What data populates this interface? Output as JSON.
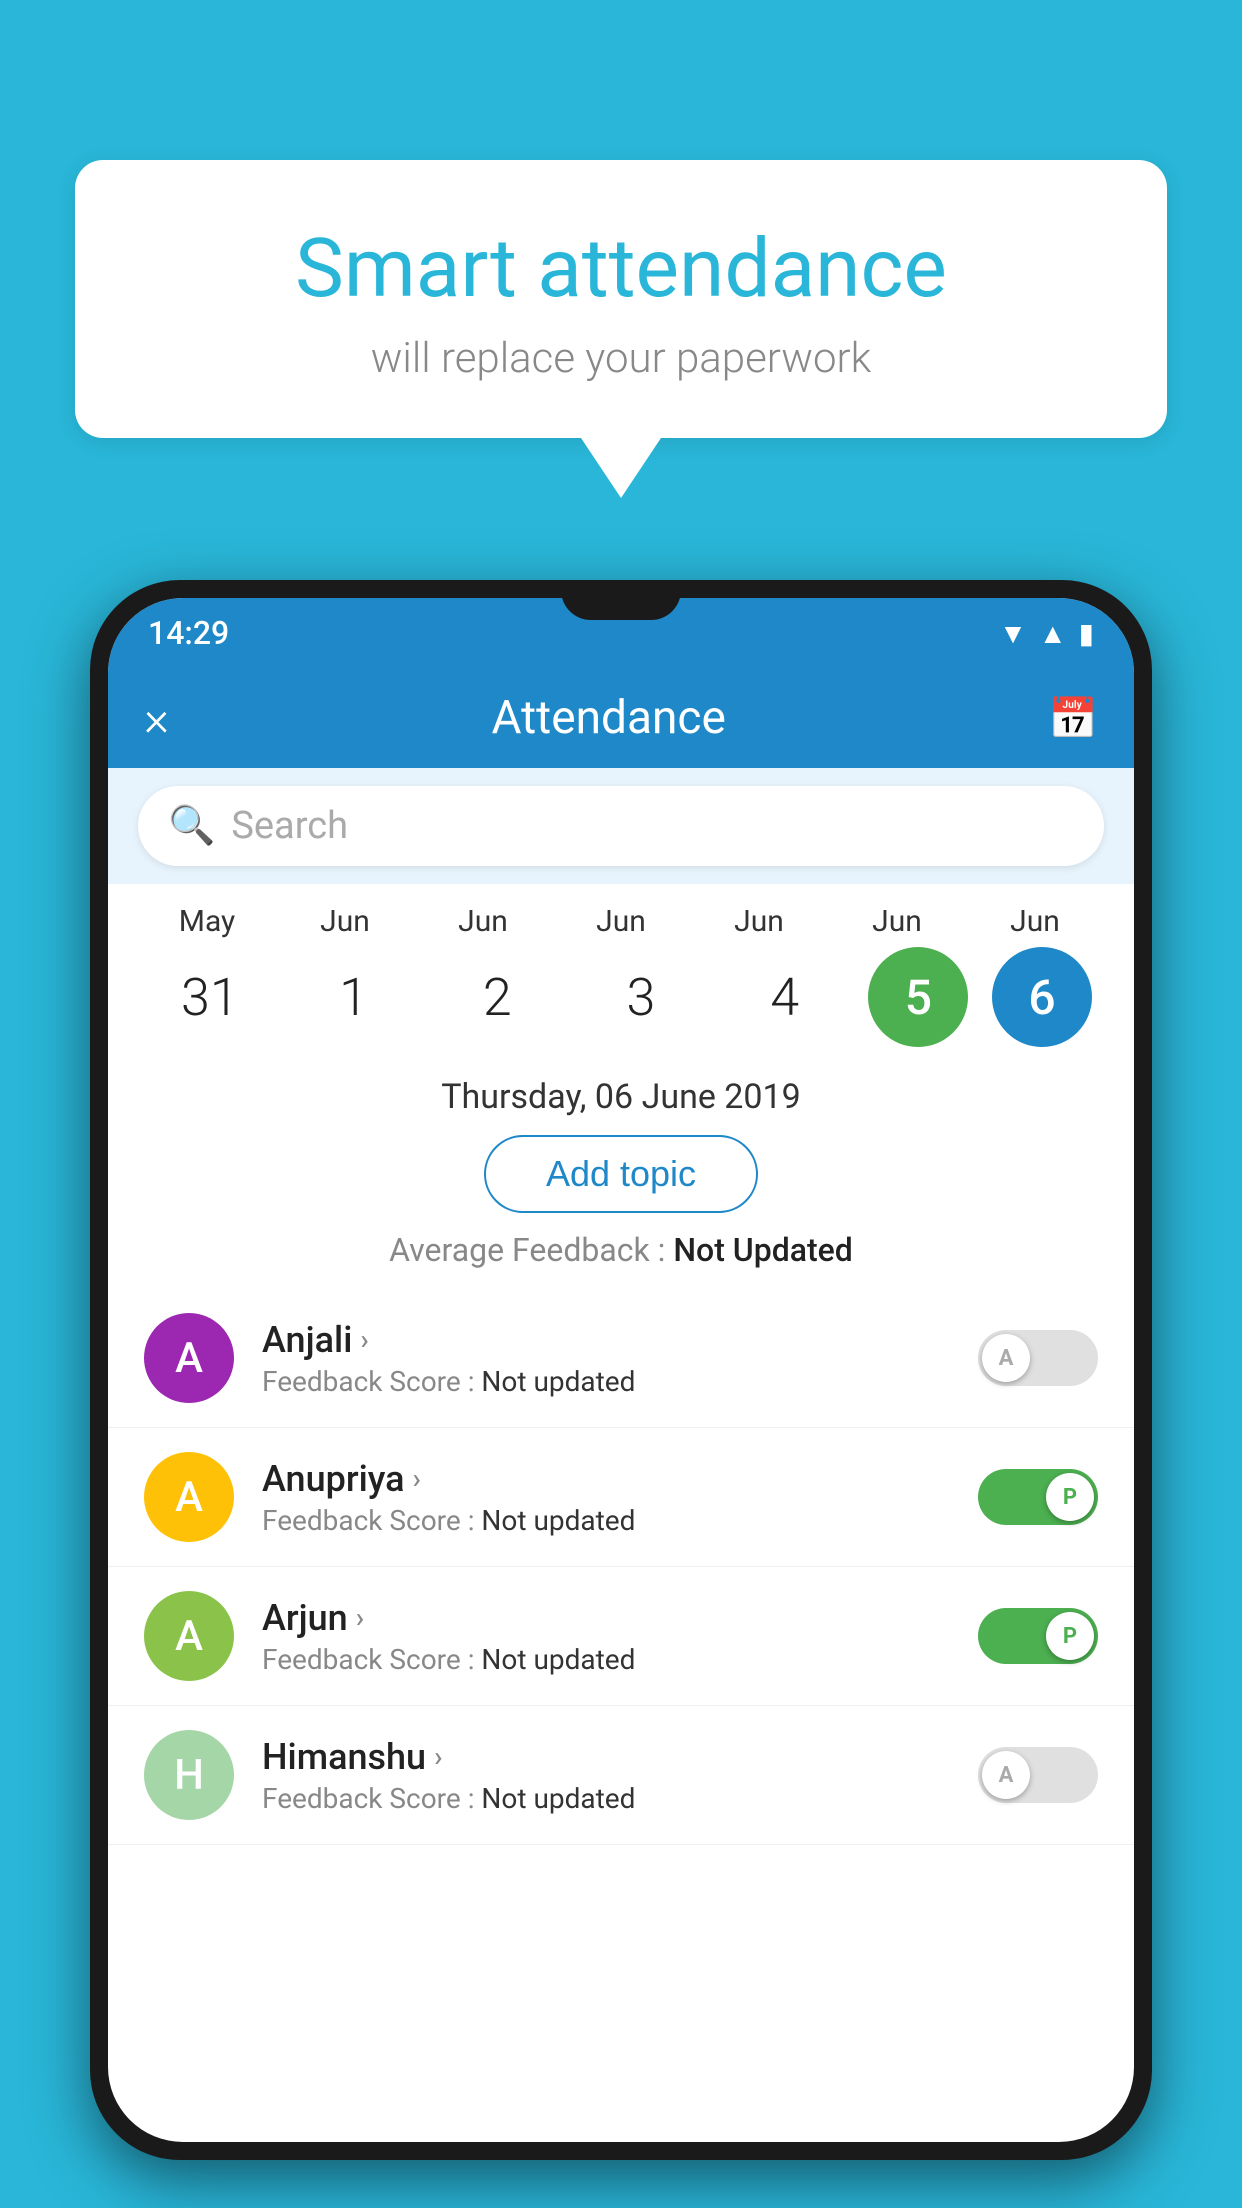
{
  "background_color": "#29b6d8",
  "speech_bubble": {
    "title": "Smart attendance",
    "subtitle": "will replace your paperwork"
  },
  "status_bar": {
    "time": "14:29",
    "icons": [
      "wifi",
      "signal",
      "battery"
    ]
  },
  "app_bar": {
    "close_label": "×",
    "title": "Attendance",
    "calendar_icon": "📅"
  },
  "search": {
    "placeholder": "Search"
  },
  "date_strip": {
    "months": [
      "May",
      "Jun",
      "Jun",
      "Jun",
      "Jun",
      "Jun",
      "Jun"
    ],
    "days": [
      "31",
      "1",
      "2",
      "3",
      "4",
      "5",
      "6"
    ],
    "today_index": 5,
    "selected_index": 6
  },
  "selected_date": {
    "label": "Thursday, 06 June 2019",
    "add_topic_label": "Add topic",
    "avg_feedback_label": "Average Feedback : ",
    "avg_feedback_value": "Not Updated"
  },
  "students": [
    {
      "name": "Anjali",
      "avatar_letter": "A",
      "avatar_color": "#9c27b0",
      "feedback_label": "Feedback Score : ",
      "feedback_value": "Not updated",
      "toggle_state": "off",
      "toggle_letter": "A"
    },
    {
      "name": "Anupriya",
      "avatar_letter": "A",
      "avatar_color": "#ffc107",
      "feedback_label": "Feedback Score : ",
      "feedback_value": "Not updated",
      "toggle_state": "on",
      "toggle_letter": "P"
    },
    {
      "name": "Arjun",
      "avatar_letter": "A",
      "avatar_color": "#8bc34a",
      "feedback_label": "Feedback Score : ",
      "feedback_value": "Not updated",
      "toggle_state": "on",
      "toggle_letter": "P"
    },
    {
      "name": "Himanshu",
      "avatar_letter": "H",
      "avatar_color": "#a5d6a7",
      "feedback_label": "Feedback Score : ",
      "feedback_value": "Not updated",
      "toggle_state": "off",
      "toggle_letter": "A"
    }
  ]
}
